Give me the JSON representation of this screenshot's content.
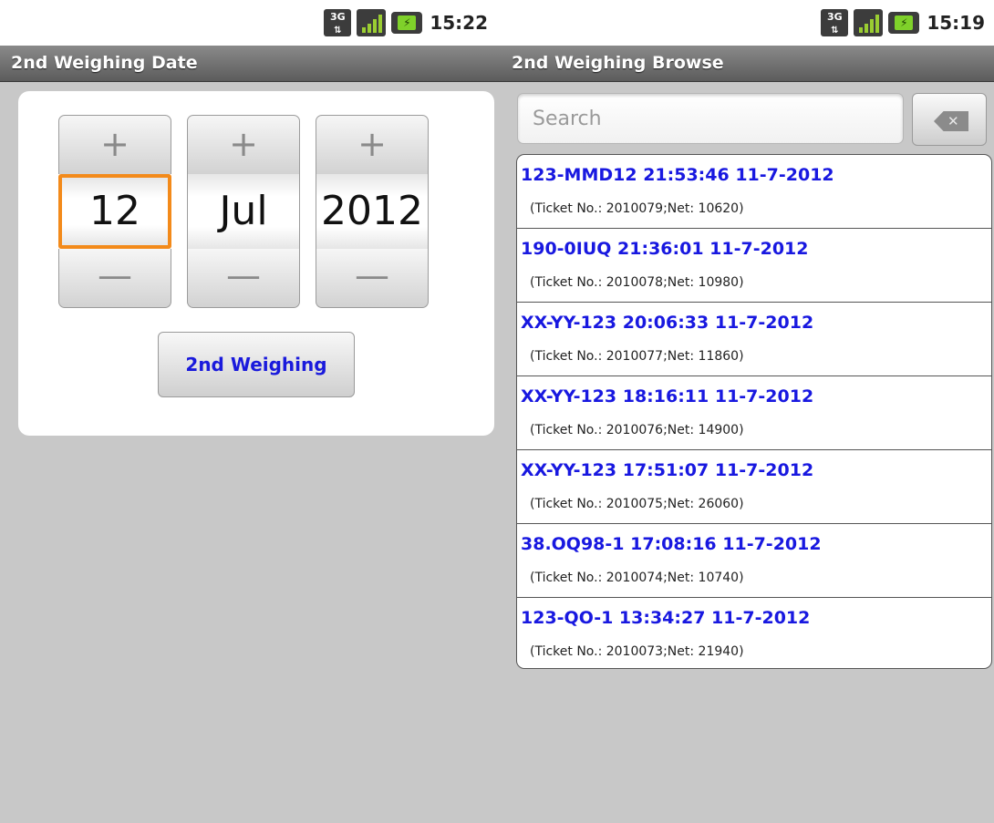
{
  "left_screen": {
    "status": {
      "network": "3G",
      "time": "15:22"
    },
    "title": "2nd Weighing Date",
    "date_picker": {
      "day": "12",
      "month": "Jul",
      "year": "2012",
      "plus_glyph": "+",
      "minus_glyph": "—"
    },
    "action_button": "2nd Weighing"
  },
  "right_screen": {
    "status": {
      "network": "3G",
      "time": "15:19"
    },
    "title": "2nd Weighing Browse",
    "search": {
      "placeholder": "Search",
      "value": ""
    },
    "clear_icon": "backspace-clear-icon",
    "items": [
      {
        "title": "123-MMD12 21:53:46 11-7-2012",
        "detail": "(Ticket No.: 2010079;Net: 10620)"
      },
      {
        "title": "190-0IUQ 21:36:01 11-7-2012",
        "detail": "(Ticket No.: 2010078;Net: 10980)"
      },
      {
        "title": "XX-YY-123 20:06:33 11-7-2012",
        "detail": "(Ticket No.: 2010077;Net: 11860)"
      },
      {
        "title": "XX-YY-123 18:16:11 11-7-2012",
        "detail": "(Ticket No.: 2010076;Net: 14900)"
      },
      {
        "title": "XX-YY-123 17:51:07 11-7-2012",
        "detail": "(Ticket No.: 2010075;Net: 26060)"
      },
      {
        "title": "38.OQ98-1 17:08:16 11-7-2012",
        "detail": "(Ticket No.: 2010074;Net: 10740)"
      },
      {
        "title": "123-QO-1 13:34:27 11-7-2012",
        "detail": "(Ticket No.: 2010073;Net: 21940)"
      }
    ]
  },
  "colors": {
    "link_blue": "#1818e0",
    "focus_orange": "#f38a1a",
    "background": "#c8c8c8",
    "battery_green": "#7fd12a"
  }
}
